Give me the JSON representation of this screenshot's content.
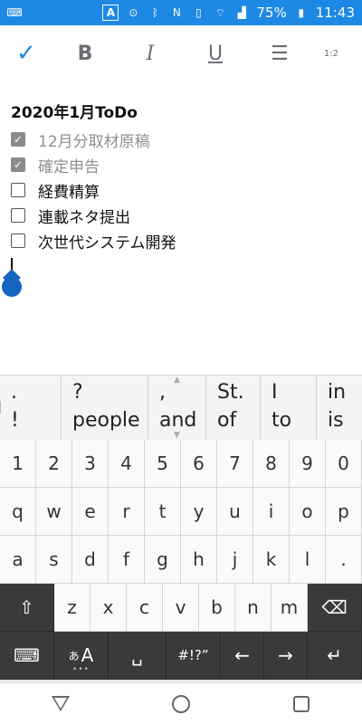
{
  "status_bar": {
    "ime_indicator": "A",
    "battery_percent": "75%",
    "time": "11:43",
    "icons": [
      "keyboard-icon",
      "location-icon",
      "bluetooth-icon",
      "nfc-icon",
      "vibrate-icon",
      "wifi-icon",
      "signal-icon",
      "battery-icon"
    ]
  },
  "toolbar": {
    "check": "✓",
    "bold": "B",
    "italic": "I",
    "underline": "U",
    "bullet_list": "☰",
    "numbered_list": "1:2"
  },
  "note": {
    "title": "2020年1月ToDo",
    "items": [
      {
        "text": "12月分取材原稿",
        "checked": true
      },
      {
        "text": "確定申告",
        "checked": true
      },
      {
        "text": "経費精算",
        "checked": false
      },
      {
        "text": "連載ネタ提出",
        "checked": false
      },
      {
        "text": "次世代システム開発",
        "checked": false
      }
    ]
  },
  "suggestions": [
    {
      "top": ".",
      "bottom": "!"
    },
    {
      "top": "?",
      "bottom": "people"
    },
    {
      "top": ",",
      "bottom": "and"
    },
    {
      "top": "St.",
      "bottom": "of"
    },
    {
      "top": "I",
      "bottom": "to"
    },
    {
      "top": "in",
      "bottom": "is"
    }
  ],
  "keyboard": {
    "row_numbers": [
      "1",
      "2",
      "3",
      "4",
      "5",
      "6",
      "7",
      "8",
      "9",
      "0"
    ],
    "row_top": [
      "q",
      "w",
      "e",
      "r",
      "t",
      "y",
      "u",
      "i",
      "o",
      "p"
    ],
    "row_home": [
      "a",
      "s",
      "d",
      "f",
      "g",
      "h",
      "j",
      "k",
      "l",
      "."
    ],
    "row_bottom": [
      "z",
      "x",
      "c",
      "v",
      "b",
      "n",
      "m"
    ],
    "shift": "⇧",
    "backspace": "⌫",
    "emoji_keyboard": "⌨",
    "lang_switch_sub": "あ",
    "lang_switch_main": "A",
    "space": "␣",
    "symbols": "#!?”",
    "arrow_left": "←",
    "arrow_right": "→",
    "enter": "↵"
  },
  "nav_bar": {
    "back": "back-icon",
    "home": "home-icon",
    "recents": "recents-icon"
  }
}
